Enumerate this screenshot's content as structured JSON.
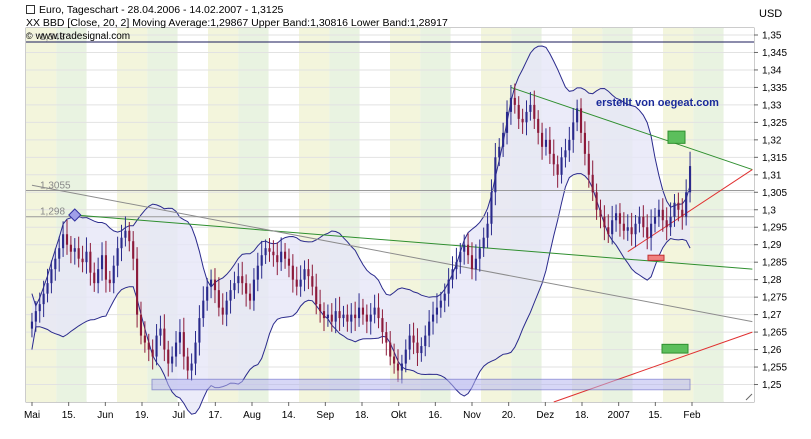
{
  "header": {
    "line1": "Euro, Tageschart - 28.04.2006 - 14.02.2007 - 1,3125",
    "line2": "XX BBD [Close, 20, 2] Moving Average:1,29867 Upper Band:1,30816 Lower Band:1,28917",
    "line3": "www.tradesignal.com",
    "currency": "USD"
  },
  "annotations": {
    "author": "erstellt von oegeat.com",
    "level_1348": "1,348",
    "level_13055": "1,3055",
    "level_1298": "1,298"
  },
  "colors": {
    "background": "#ffffff",
    "band_fill": "#e6e6f8",
    "band_line": "#2a2a8c",
    "up_candle": "#2a2a8c",
    "down_candle": "#8c1a3a",
    "support_green": "#2f8f2f",
    "trend_red": "#e03030",
    "reference_gray": "#8c8c8c",
    "stripe_yellow": "#f3f5dc",
    "stripe_green": "#e9f3e1"
  },
  "chart_data": {
    "type": "candlestick",
    "ylim": [
      1.245,
      1.352
    ],
    "yticks": [
      "1,25",
      "1,255",
      "1,26",
      "1,265",
      "1,27",
      "1,275",
      "1,28",
      "1,285",
      "1,29",
      "1,295",
      "1,3",
      "1,305",
      "1,31",
      "1,315",
      "1,32",
      "1,325",
      "1,33",
      "1,335",
      "1,34",
      "1,345",
      "1,35"
    ],
    "xlabels": [
      "Mai",
      "15.",
      "Jun",
      "19.",
      "Jul",
      "17.",
      "Aug",
      "14.",
      "Sep",
      "18.",
      "Okt",
      "16.",
      "Nov",
      "20.",
      "Dez",
      "18.",
      "2007",
      "15.",
      "Feb"
    ],
    "close_series": [
      1.268,
      1.271,
      1.273,
      1.276,
      1.279,
      1.283,
      1.286,
      1.289,
      1.293,
      1.29,
      1.288,
      1.289,
      1.286,
      1.285,
      1.288,
      1.282,
      1.279,
      1.283,
      1.287,
      1.28,
      1.279,
      1.284,
      1.289,
      1.292,
      1.294,
      1.291,
      1.286,
      1.27,
      1.264,
      1.262,
      1.26,
      1.258,
      1.264,
      1.266,
      1.26,
      1.256,
      1.258,
      1.262,
      1.265,
      1.258,
      1.254,
      1.256,
      1.262,
      1.269,
      1.274,
      1.278,
      1.28,
      1.277,
      1.272,
      1.27,
      1.274,
      1.277,
      1.279,
      1.281,
      1.279,
      1.276,
      1.274,
      1.28,
      1.284,
      1.287,
      1.289,
      1.288,
      1.287,
      1.285,
      1.288,
      1.286,
      1.284,
      1.28,
      1.278,
      1.28,
      1.283,
      1.281,
      1.278,
      1.273,
      1.271,
      1.269,
      1.27,
      1.268,
      1.271,
      1.269,
      1.27,
      1.268,
      1.27,
      1.269,
      1.272,
      1.27,
      1.268,
      1.27,
      1.272,
      1.269,
      1.265,
      1.262,
      1.258,
      1.256,
      1.254,
      1.256,
      1.26,
      1.264,
      1.262,
      1.259,
      1.261,
      1.264,
      1.268,
      1.27,
      1.272,
      1.274,
      1.276,
      1.28,
      1.283,
      1.285,
      1.288,
      1.29,
      1.287,
      1.283,
      1.286,
      1.289,
      1.292,
      1.296,
      1.305,
      1.315,
      1.318,
      1.322,
      1.328,
      1.332,
      1.33,
      1.326,
      1.325,
      1.328,
      1.33,
      1.326,
      1.322,
      1.318,
      1.32,
      1.316,
      1.313,
      1.31,
      1.315,
      1.317,
      1.32,
      1.325,
      1.329,
      1.322,
      1.316,
      1.31,
      1.305,
      1.3,
      1.298,
      1.295,
      1.293,
      1.297,
      1.299,
      1.296,
      1.294,
      1.295,
      1.293,
      1.296,
      1.298,
      1.295,
      1.292,
      1.296,
      1.298,
      1.3,
      1.297,
      1.295,
      1.298,
      1.302,
      1.3,
      1.298,
      1.305,
      1.3125
    ],
    "upper_band_last": 1.30816,
    "moving_average_last": 1.29867,
    "lower_band_last": 1.28917,
    "horizontal_levels": [
      1.348,
      1.3055,
      1.298
    ],
    "grid": true,
    "legend": "top-left"
  }
}
